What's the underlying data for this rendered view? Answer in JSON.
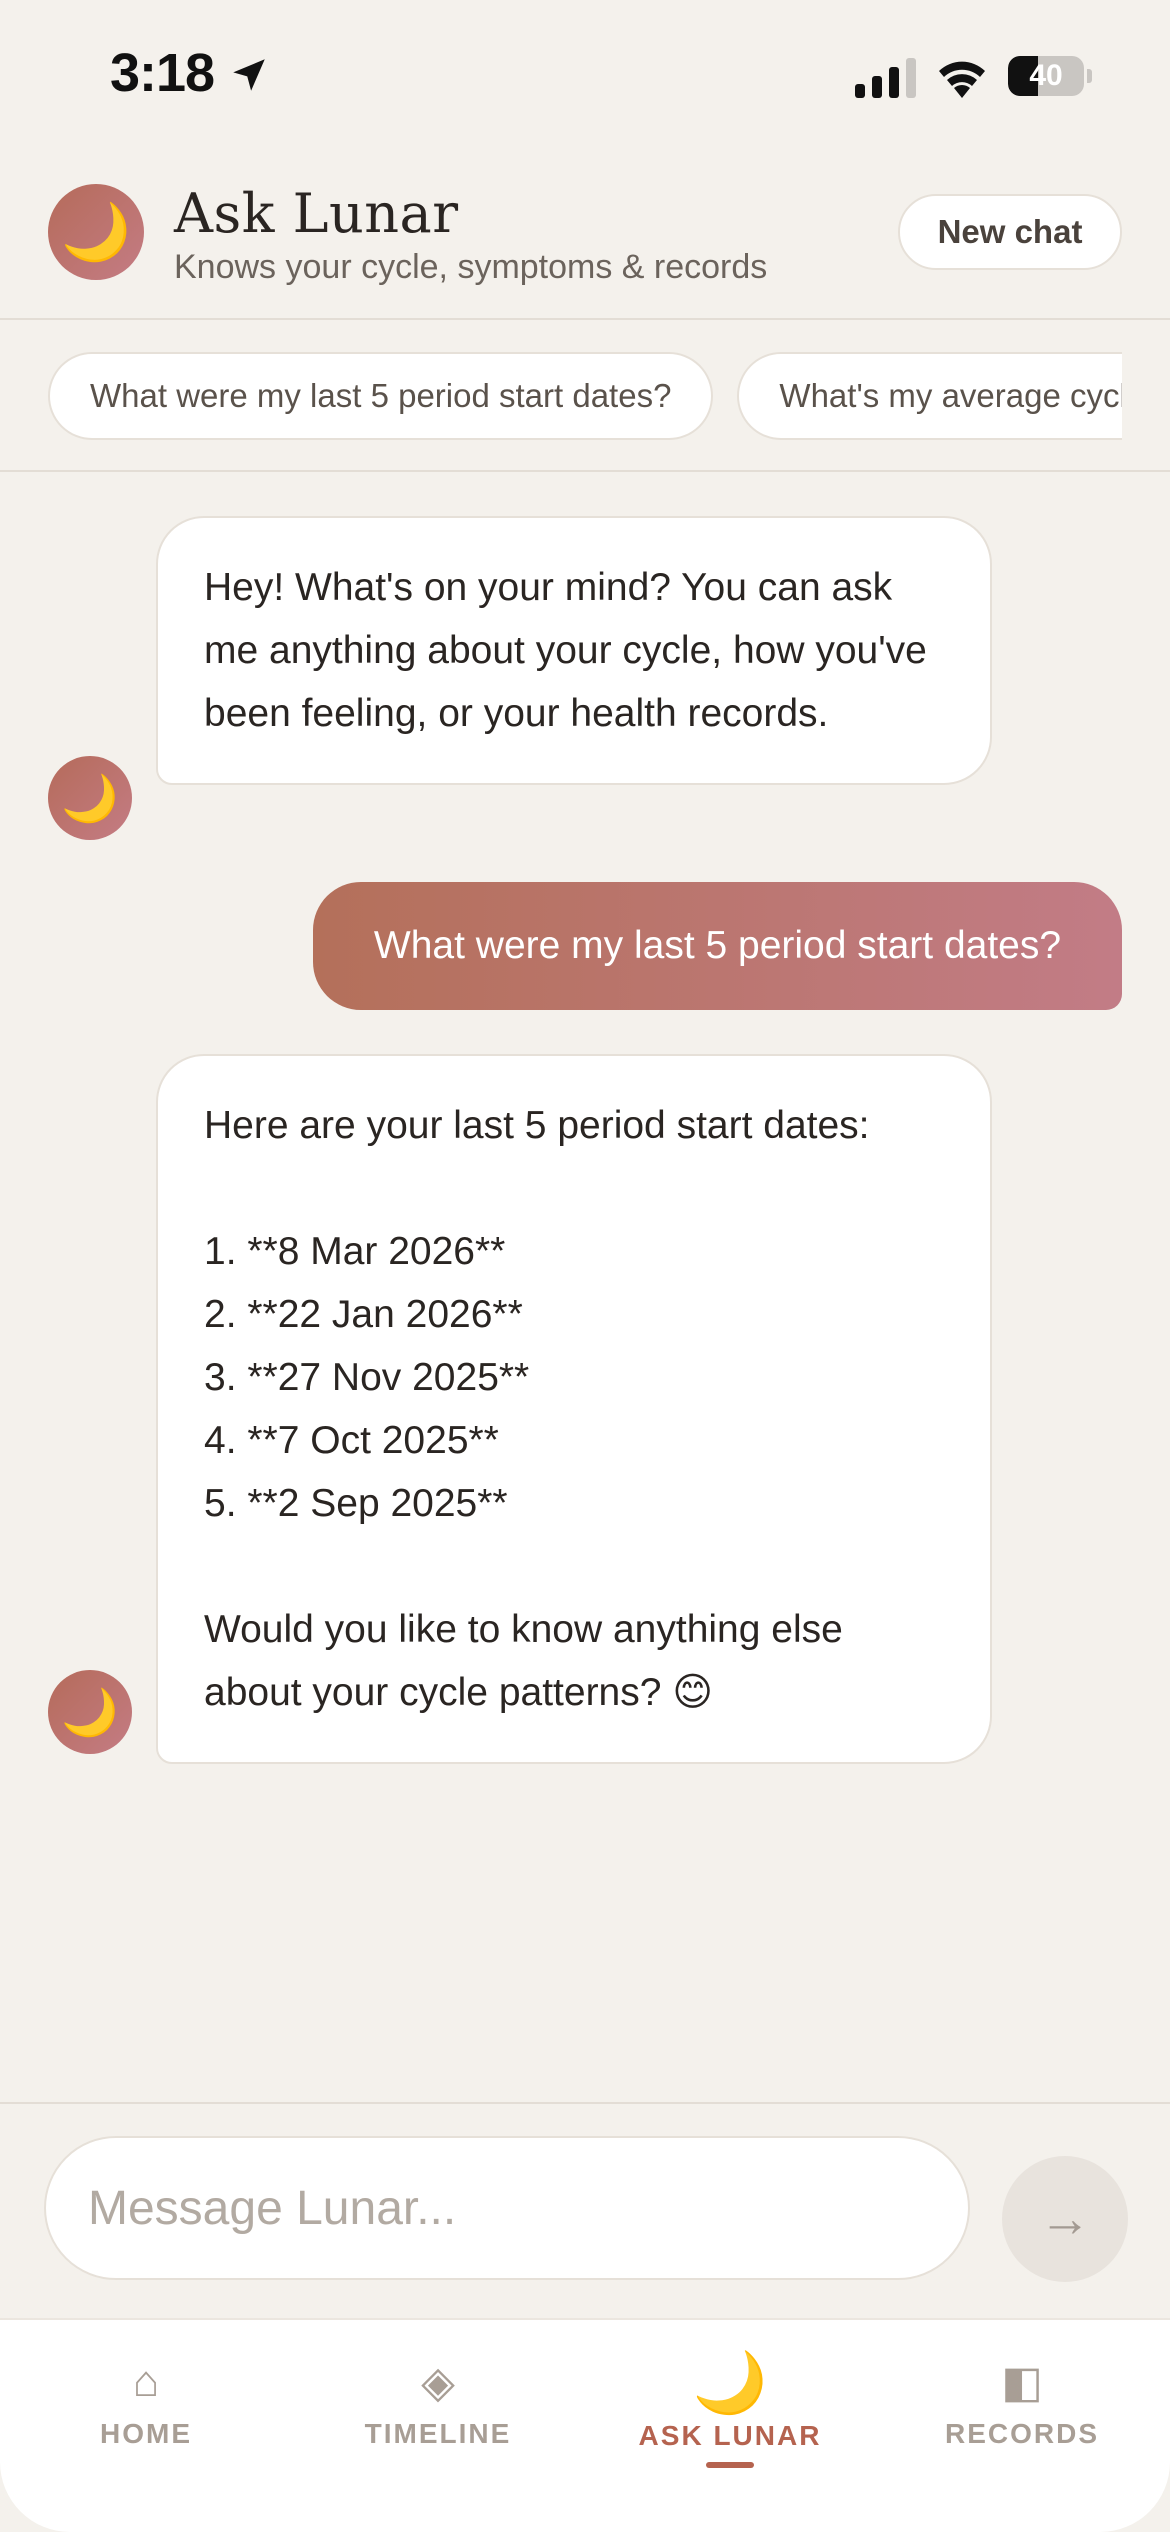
{
  "status_bar": {
    "time": "3:18",
    "battery_percent": "40",
    "battery_level": 0.4
  },
  "header": {
    "avatar_emoji": "🌙",
    "title": "Ask Lunar",
    "subtitle": "Knows your cycle, symptoms & records",
    "new_chat_label": "New chat"
  },
  "suggestions": [
    "What were my last 5 period start dates?",
    "What's my average cycle length?"
  ],
  "messages": [
    {
      "role": "assistant",
      "text": "Hey! What's on your mind? You can ask me anything about your cycle, how you've been feeling, or your health records."
    },
    {
      "role": "user",
      "text": "What were my last 5 period start dates?"
    },
    {
      "role": "assistant",
      "text": "Here are your last 5 period start dates:\n\n1. **8 Mar 2026**\n2. **22 Jan 2026**\n3. **27 Nov 2025**\n4. **7 Oct 2025**\n5. **2 Sep 2025**\n\nWould you like to know anything else about your cycle patterns? 😊"
    }
  ],
  "composer": {
    "placeholder": "Message Lunar...",
    "send_icon": "→"
  },
  "tabs": [
    {
      "label": "HOME",
      "icon": "⌂"
    },
    {
      "label": "TIMELINE",
      "icon": "◈"
    },
    {
      "label": "ASK LUNAR",
      "icon": "🌙"
    },
    {
      "label": "RECORDS",
      "icon": "◧"
    }
  ],
  "colors": {
    "accent": "#b5634f",
    "background": "#f4f1ec",
    "user_bubble_start": "#b4705a",
    "user_bubble_end": "#c27c86"
  }
}
